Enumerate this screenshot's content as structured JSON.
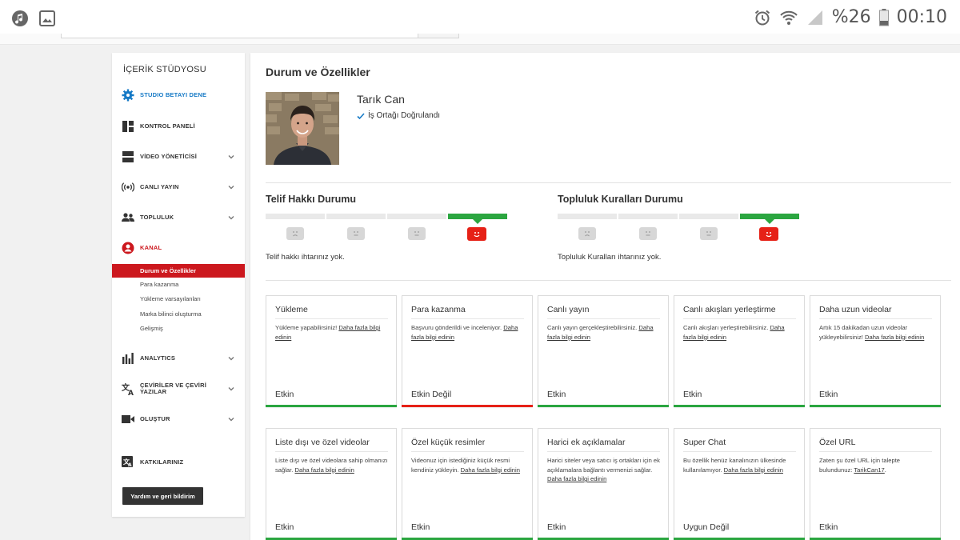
{
  "statusbar": {
    "battery": "%26",
    "time": "00:10"
  },
  "sidebar": {
    "title": "İÇERİK STÜDYOSU",
    "items": [
      {
        "label": "STUDIO BETAYI DENE",
        "icon": "gear-icon"
      },
      {
        "label": "KONTROL PANELİ",
        "icon": "dashboard-icon"
      },
      {
        "label": "VİDEO YÖNETİCİSİ",
        "icon": "video-manager-icon"
      },
      {
        "label": "CANLI YAYIN",
        "icon": "broadcast-icon"
      },
      {
        "label": "TOPLULUK",
        "icon": "community-icon"
      },
      {
        "label": "KANAL",
        "icon": "channel-icon"
      },
      {
        "label": "ANALYTICS",
        "icon": "analytics-icon"
      },
      {
        "label": "ÇEVİRİLER VE ÇEVİRİ YAZILAR",
        "icon": "translate-icon"
      },
      {
        "label": "OLUŞTUR",
        "icon": "create-icon"
      },
      {
        "label": "KATKILARINIZ",
        "icon": "contributions-icon"
      }
    ],
    "sub_items": [
      {
        "label": "Durum ve Özellikler"
      },
      {
        "label": "Para kazanma"
      },
      {
        "label": "Yükleme varsayılanları"
      },
      {
        "label": "Marka bilinci oluşturma"
      },
      {
        "label": "Gelişmiş"
      }
    ],
    "help_button": "Yardım ve geri bildirim"
  },
  "main": {
    "title": "Durum ve Özellikler",
    "channel_name": "Tarık Can",
    "verified": "İş Ortağı Doğrulandı",
    "copyright": {
      "title": "Telif Hakkı Durumu",
      "text": "Telif hakkı ihtarınız yok."
    },
    "community": {
      "title": "Topluluk Kuralları Durumu",
      "text": "Topluluk Kuralları ihtarınız yok."
    },
    "cards": [
      {
        "title": "Yükleme",
        "desc": "Yükleme yapabilirsiniz!",
        "link": "Daha fazla bilgi edinin",
        "status": "Etkin",
        "color": "#2ba640"
      },
      {
        "title": "Para kazanma",
        "desc": "Başvuru gönderildi ve inceleniyor.",
        "link": "Daha fazla bilgi edinin",
        "status": "Etkin Değil",
        "color": "#e62117"
      },
      {
        "title": "Canlı yayın",
        "desc": "Canlı yayın gerçekleştirebilirsiniz.",
        "link": "Daha fazla bilgi edinin",
        "status": "Etkin",
        "color": "#2ba640"
      },
      {
        "title": "Canlı akışları yerleştirme",
        "desc": "Canlı akışları yerleştirebilirsiniz.",
        "link": "Daha fazla bilgi edinin",
        "status": "Etkin",
        "color": "#2ba640"
      },
      {
        "title": "Daha uzun videolar",
        "desc": "Artık 15 dakikadan uzun videolar yükleyebilirsiniz!",
        "link": "Daha fazla bilgi edinin",
        "status": "Etkin",
        "color": "#2ba640"
      },
      {
        "title": "Liste dışı ve özel videolar",
        "desc": "Liste dışı ve özel videolara sahip olmanızı sağlar.",
        "link": "Daha fazla bilgi edinin",
        "status": "Etkin",
        "color": "#2ba640"
      },
      {
        "title": "Özel küçük resimler",
        "desc": "Videonuz için istediğiniz küçük resmi kendiniz yükleyin.",
        "link": "Daha fazla bilgi edinin",
        "status": "Etkin",
        "color": "#2ba640"
      },
      {
        "title": "Harici ek açıklamalar",
        "desc": "Harici siteler veya satıcı iş ortakları için ek açıklamalara bağlantı vermenizi sağlar.",
        "link": "Daha fazla bilgi edinin",
        "status": "Etkin",
        "color": "#2ba640"
      },
      {
        "title": "Super Chat",
        "desc": "Bu özellik henüz kanalınızın ülkesinde kullanılamıyor.",
        "link": "Daha fazla bilgi edinin",
        "status": "Uygun Değil",
        "color": "#2ba640"
      },
      {
        "title": "Özel URL",
        "desc": "Zaten şu özel URL için talepte bulundunuz:",
        "link": "TarikCan17",
        "status": "Etkin",
        "color": "#2ba640"
      }
    ]
  }
}
